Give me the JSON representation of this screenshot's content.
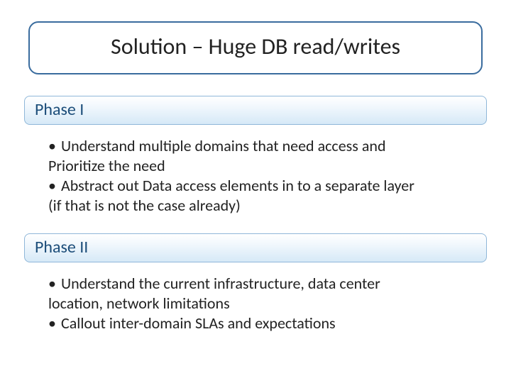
{
  "title": "Solution – Huge DB read/writes",
  "sections": [
    {
      "header": "Phase I",
      "bullets": [
        {
          "lead": "Understand multiple domains that need access and",
          "cont": "Prioritize the need"
        },
        {
          "lead": "Abstract out Data access elements in to a separate layer",
          "cont": "(if that is not the case already)"
        }
      ]
    },
    {
      "header": "Phase II",
      "bullets": [
        {
          "lead": "Understand the current infrastructure, data center",
          "cont": "location, network limitations"
        },
        {
          "lead": "Callout inter-domain SLAs and expectations",
          "cont": ""
        }
      ]
    }
  ],
  "bullet_char": "•"
}
